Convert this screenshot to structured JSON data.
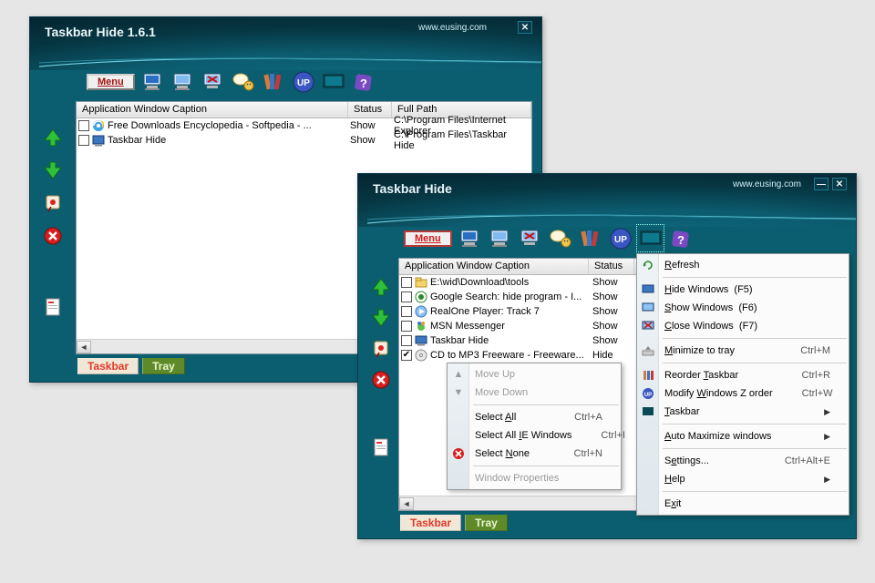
{
  "window1": {
    "title": "Taskbar Hide 1.6.1",
    "url": "www.eusing.com",
    "menu_label": "Menu",
    "columns": {
      "app": "Application  Window Caption",
      "status": "Status",
      "path": "Full Path"
    },
    "rows": [
      {
        "caption": "Free Downloads Encyclopedia - Softpedia - ...",
        "status": "Show",
        "path": "C:\\Program Files\\Internet Explorer",
        "icon": "ie"
      },
      {
        "caption": "Taskbar Hide",
        "status": "Show",
        "path": "C:\\Program Files\\Taskbar Hide",
        "icon": "app"
      }
    ],
    "tabs": {
      "taskbar": "Taskbar",
      "tray": "Tray"
    }
  },
  "window2": {
    "title": "Taskbar Hide",
    "url": "www.eusing.com",
    "menu_label": "Menu",
    "columns": {
      "app": "Application  Window Caption",
      "status": "Status"
    },
    "rows": [
      {
        "caption": "E:\\wid\\Download\\tools",
        "status": "Show",
        "checked": false,
        "icon": "folder"
      },
      {
        "caption": "Google Search: hide program - I...",
        "status": "Show",
        "checked": false,
        "icon": "web"
      },
      {
        "caption": "RealOne Player: Track 7",
        "status": "Show",
        "checked": false,
        "icon": "real"
      },
      {
        "caption": "MSN Messenger",
        "status": "Show",
        "checked": false,
        "icon": "msn"
      },
      {
        "caption": "Taskbar Hide",
        "status": "Show",
        "checked": false,
        "icon": "app"
      },
      {
        "caption": "CD to MP3 Freeware - Freeware...",
        "status": "Hide",
        "checked": true,
        "icon": "cd"
      }
    ],
    "tabs": {
      "taskbar": "Taskbar",
      "tray": "Tray"
    }
  },
  "context_small": {
    "move_up": "Move Up",
    "move_down": "Move Down",
    "select_all": "Select All",
    "select_all_sc": "Ctrl+A",
    "select_ie": "Select All IE Windows",
    "select_ie_sc": "Ctrl+I",
    "select_none": "Select None",
    "select_none_sc": "Ctrl+N",
    "win_props": "Window Properties"
  },
  "context_large": {
    "refresh": "Refresh",
    "hide_w": "Hide Windows  (F5)",
    "show_w": "Show Windows  (F6)",
    "close_w": "Close Windows  (F7)",
    "min_tray": "Minimize to tray",
    "min_tray_sc": "Ctrl+M",
    "reorder": "Reorder Taskbar",
    "reorder_sc": "Ctrl+R",
    "zorder": "Modify Windows Z order",
    "zorder_sc": "Ctrl+W",
    "taskbar": "Taskbar",
    "automax": "Auto Maximize windows",
    "settings": "Settings...",
    "settings_sc": "Ctrl+Alt+E",
    "help": "Help",
    "exit": "Exit"
  },
  "toolbar_icons": [
    "monitor1",
    "monitor2",
    "monitor-x",
    "chat",
    "books",
    "up",
    "screen",
    "help"
  ],
  "side_icons": [
    "arrow-up-green",
    "arrow-down-green",
    "pin-red",
    "close-red",
    "gap",
    "page"
  ]
}
